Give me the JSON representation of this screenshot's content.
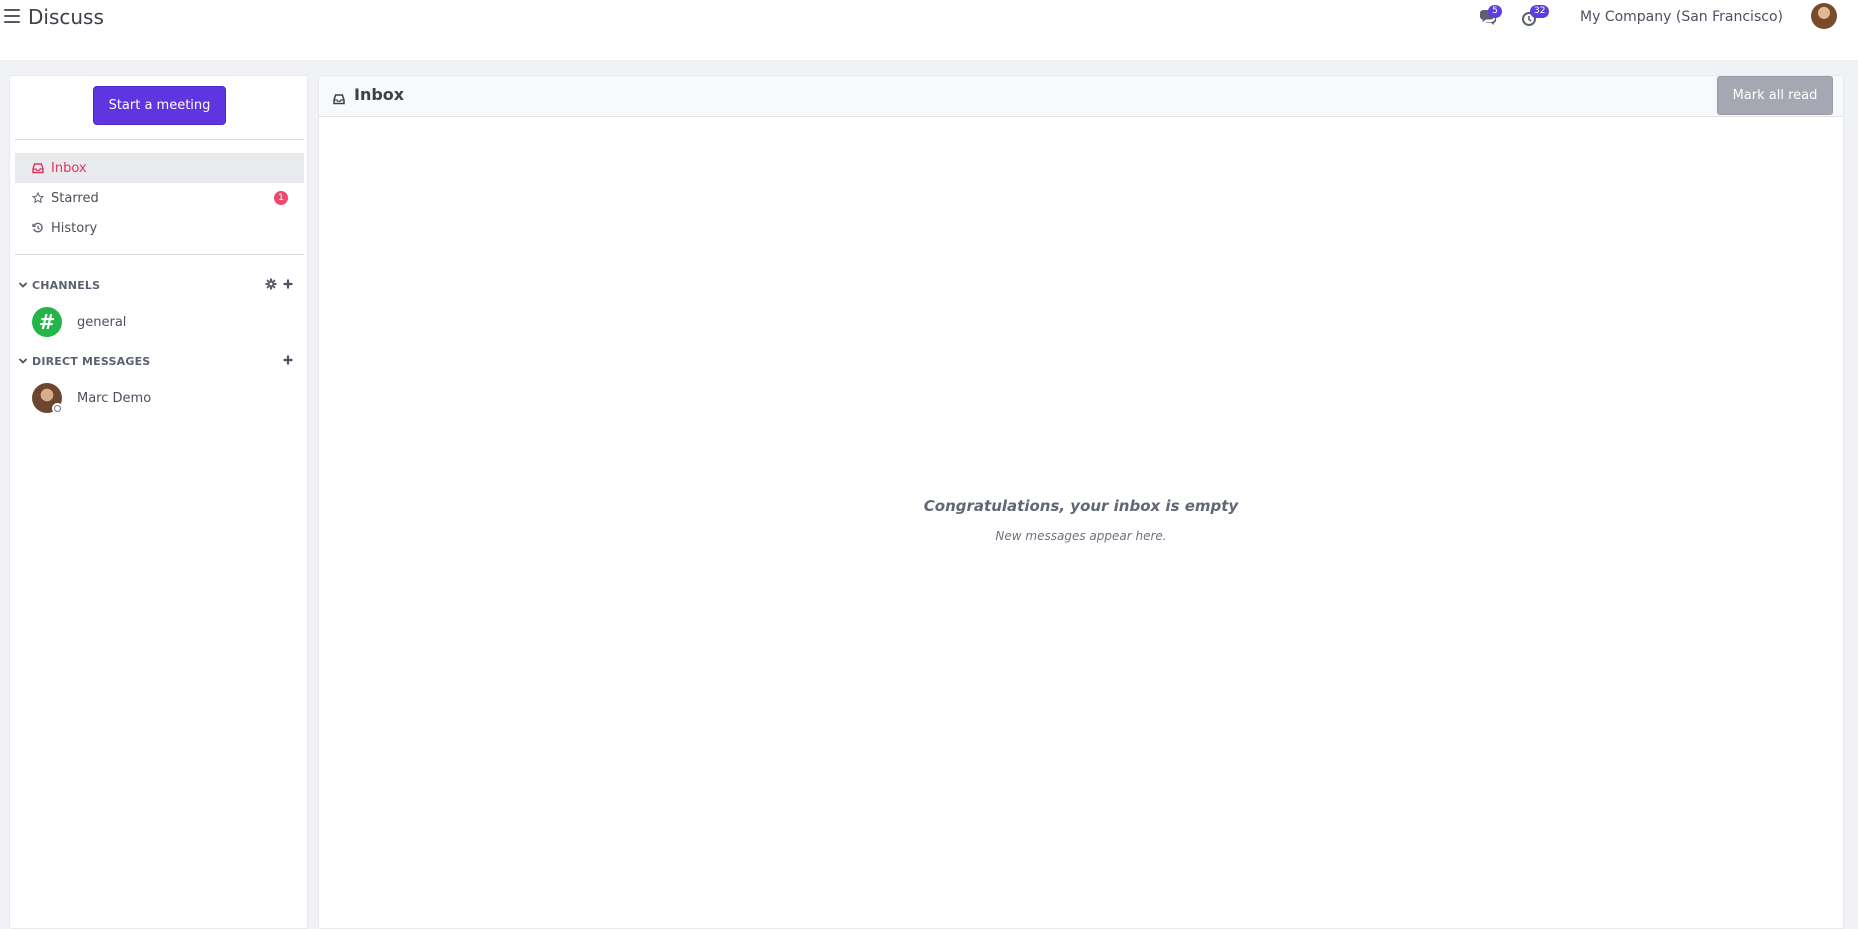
{
  "topbar": {
    "app_title": "Discuss",
    "messages_badge": "5",
    "activities_badge": "32",
    "company": "My Company (San Francisco)"
  },
  "sidebar": {
    "start_meeting_label": "Start a meeting",
    "nav": [
      {
        "label": "Inbox",
        "icon": "inbox-icon",
        "active": true
      },
      {
        "label": "Starred",
        "icon": "star-icon",
        "badge": "1"
      },
      {
        "label": "History",
        "icon": "history-icon"
      }
    ],
    "channels_label": "CHANNELS",
    "channels": [
      {
        "label": "general",
        "avatar_glyph": "#"
      }
    ],
    "dm_label": "DIRECT MESSAGES",
    "direct_messages": [
      {
        "label": "Marc Demo"
      }
    ]
  },
  "main": {
    "title": "Inbox",
    "mark_all_read_label": "Mark all read",
    "empty_title": "Congratulations, your inbox is empty",
    "empty_subtitle": "New messages appear here."
  },
  "colors": {
    "accent": "#5f35e0",
    "active_nav": "#e0335f",
    "channel_avatar": "#21b54a",
    "badge": "#ea4a6f"
  }
}
